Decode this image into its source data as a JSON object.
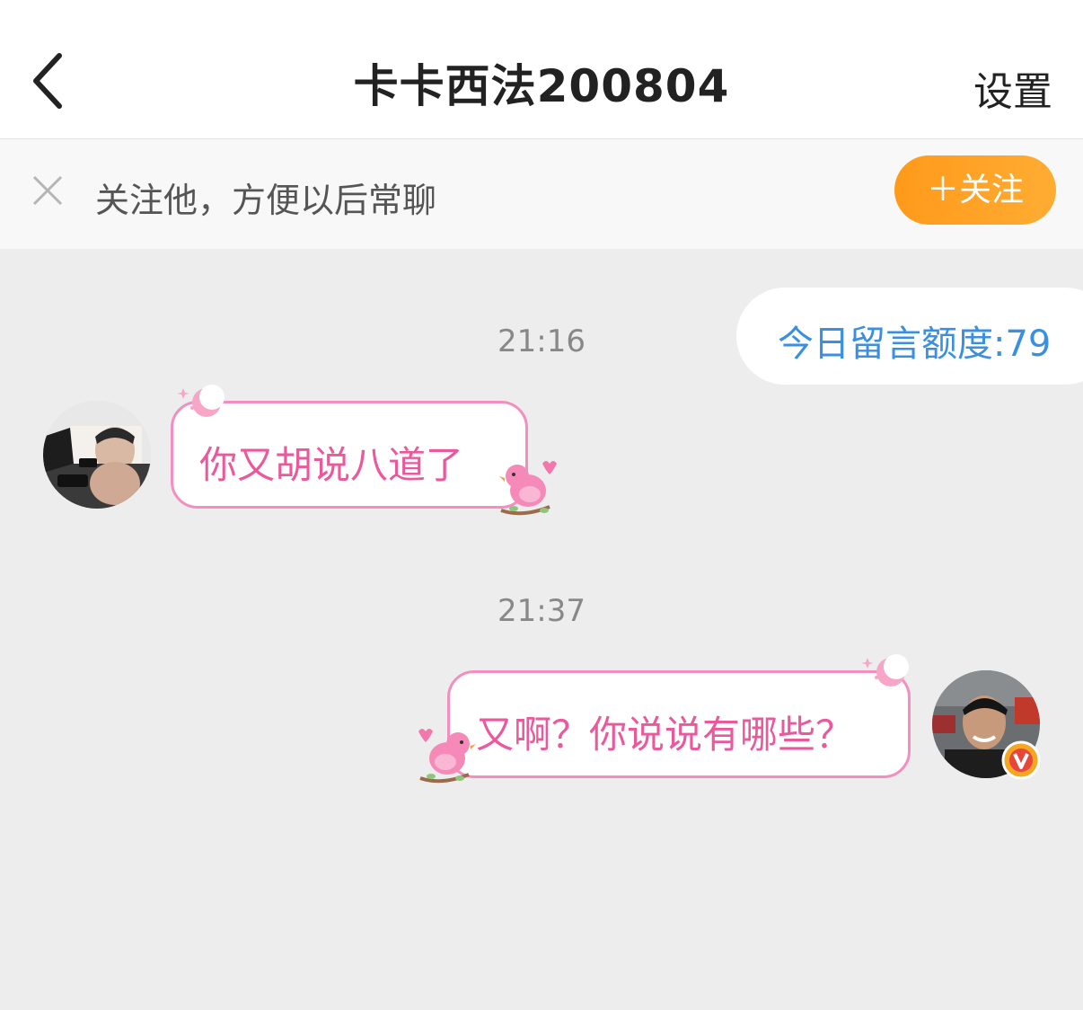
{
  "navbar": {
    "title": "卡卡西法200804",
    "settings_label": "设置"
  },
  "follow_bar": {
    "prompt": "关注他，方便以后常聊",
    "follow_label": "＋关注"
  },
  "quota": {
    "label": "今日留言额度:79"
  },
  "messages": [
    {
      "time": "21:16",
      "side": "left",
      "text": "你又胡说八道了"
    },
    {
      "time": "21:37",
      "side": "right",
      "text": "又啊？你说说有哪些？"
    }
  ],
  "colors": {
    "accent_orange": "#ff9a1a",
    "bubble_pink": "#f28fc0",
    "text_pink": "#e9599c",
    "quota_blue": "#3b8fe0"
  }
}
